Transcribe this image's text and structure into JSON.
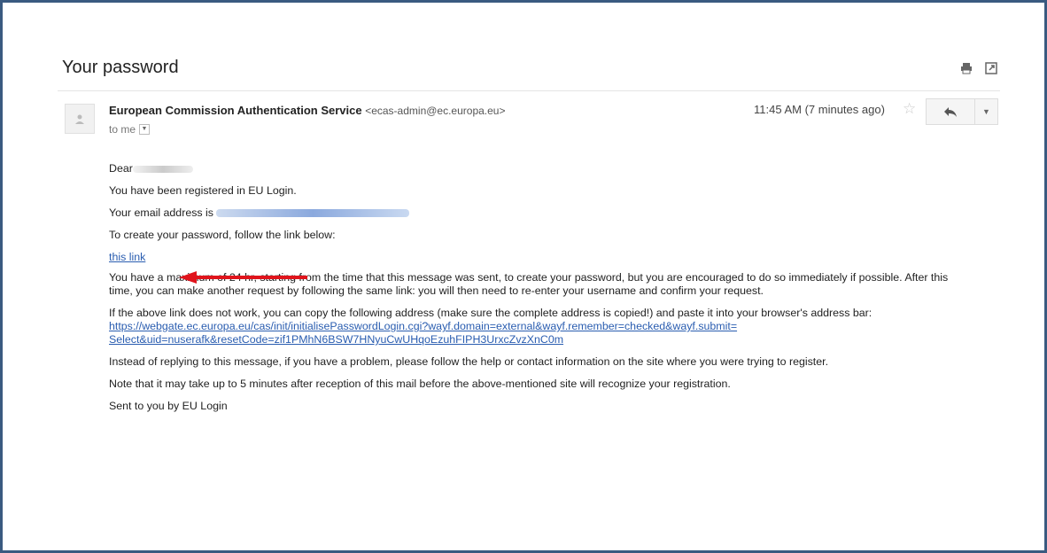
{
  "email": {
    "subject": "Your password",
    "sender_name": "European Commission Authentication Service",
    "sender_email": "<ecas-admin@ec.europa.eu>",
    "recipient": "to me",
    "time": "11:45 AM (7 minutes ago)"
  },
  "icons": {
    "print": "print-icon",
    "new_window": "open-in-new-window-icon",
    "star": "star-icon",
    "reply": "reply-icon",
    "more": "chevron-down-icon",
    "avatar": "person-icon"
  },
  "body": {
    "greeting": "Dear",
    "line1": "You have been registered in EU Login.",
    "line2": "Your email address is",
    "line3": "To create your password, follow the link below:",
    "link_text": "this link",
    "para1": "You have a maximum of 24 hr, starting from the time that this message was sent, to create your password, but you are encouraged to do so immediately if possible. After this time, you can make another request by following the same link: you will then need to re-enter your username and confirm your request.",
    "para2": "If the above link does not work, you can copy the following address (make sure the complete address is copied!) and paste it into your browser's address bar:",
    "url_line1": "https://webgate.ec.europa.eu/cas/init/initialisePasswordLogin.cgi?wayf.domain=external&wayf.remember=checked&wayf.submit=",
    "url_line2": "Select&uid=nuserafk&resetCode=zif1PMhN6BSW7HNyuCwUHqoEzuhFIPH3UrxcZvzXnC0m",
    "para3": "Instead of replying to this message, if you have a problem, please follow the help or contact information on the site where you were trying to register.",
    "para4": "Note that it may take up to 5 minutes after reception of this mail before the above-mentioned site will recognize your registration.",
    "signoff": "Sent to you by EU Login"
  },
  "colors": {
    "frame_border": "#3a5a80",
    "link": "#2a5db0",
    "annotation_arrow": "#e0141c"
  }
}
